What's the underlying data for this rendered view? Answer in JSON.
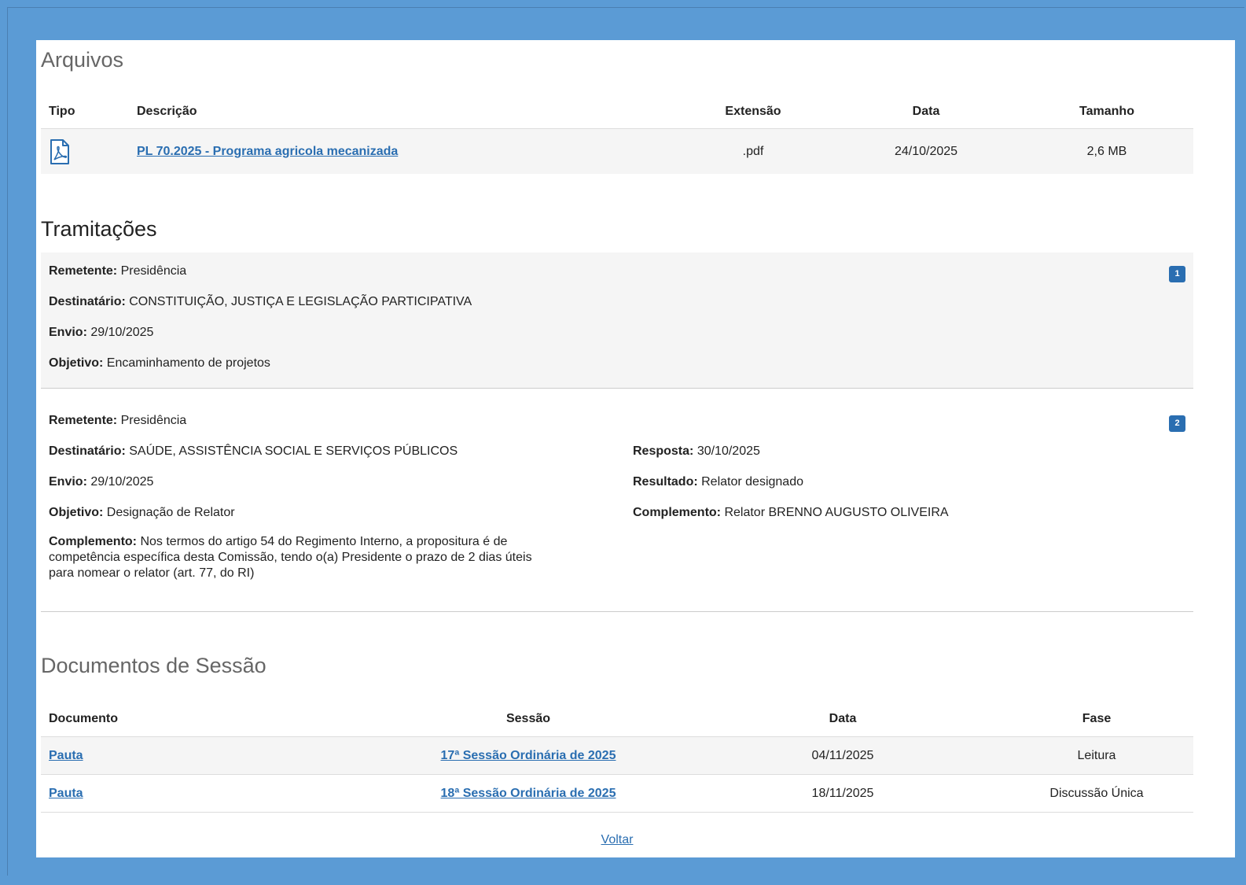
{
  "arquivos": {
    "title": "Arquivos",
    "headers": {
      "tipo": "Tipo",
      "descricao": "Descrição",
      "extensao": "Extensão",
      "data": "Data",
      "tamanho": "Tamanho"
    },
    "rows": [
      {
        "icon": "pdf-file-icon",
        "descricao": "PL 70.2025 - Programa agricola mecanizada",
        "extensao": ".pdf",
        "data": "24/10/2025",
        "tamanho": "2,6 MB"
      }
    ]
  },
  "tramitacoes": {
    "title": "Tramitações",
    "items": [
      {
        "badge": "1",
        "remetente_label": "Remetente:",
        "remetente": "Presidência",
        "destinatario_label": "Destinatário:",
        "destinatario": "CONSTITUIÇÃO, JUSTIÇA E LEGISLAÇÃO PARTICIPATIVA",
        "envio_label": "Envio:",
        "envio": "29/10/2025",
        "objetivo_label": "Objetivo:",
        "objetivo": "Encaminhamento de projetos"
      },
      {
        "badge": "2",
        "remetente_label": "Remetente:",
        "remetente": "Presidência",
        "destinatario_label": "Destinatário:",
        "destinatario": "SAÚDE, ASSISTÊNCIA SOCIAL E SERVIÇOS PÚBLICOS",
        "envio_label": "Envio:",
        "envio": "29/10/2025",
        "objetivo_label": "Objetivo:",
        "objetivo": "Designação de Relator",
        "complemento_label": "Complemento:",
        "complemento_line1": "Nos termos do artigo 54 do Regimento Interno, a propositura é de",
        "complemento_line2": "competência específica desta Comissão, tendo o(a) Presidente o prazo de 2 dias úteis",
        "complemento_line3": "para nomear o relator (art. 77, do RI)",
        "resposta_label": "Resposta:",
        "resposta": "30/10/2025",
        "resultado_label": "Resultado:",
        "resultado": "Relator designado",
        "complemento2_label": "Complemento:",
        "complemento2": "Relator BRENNO AUGUSTO OLIVEIRA"
      }
    ]
  },
  "documentos": {
    "title": "Documentos de Sessão",
    "headers": {
      "documento": "Documento",
      "sessao": "Sessão",
      "data": "Data",
      "fase": "Fase"
    },
    "rows": [
      {
        "documento": "Pauta",
        "sessao": "17ª Sessão Ordinária de 2025",
        "data": "04/11/2025",
        "fase": "Leitura"
      },
      {
        "documento": "Pauta",
        "sessao": "18ª Sessão Ordinária de 2025",
        "data": "18/11/2025",
        "fase": "Discussão Única"
      }
    ]
  },
  "voltar": "Voltar",
  "colors": {
    "background": "#5b9bd5",
    "link": "#2a6eb1",
    "badge": "#2a6eb1"
  }
}
